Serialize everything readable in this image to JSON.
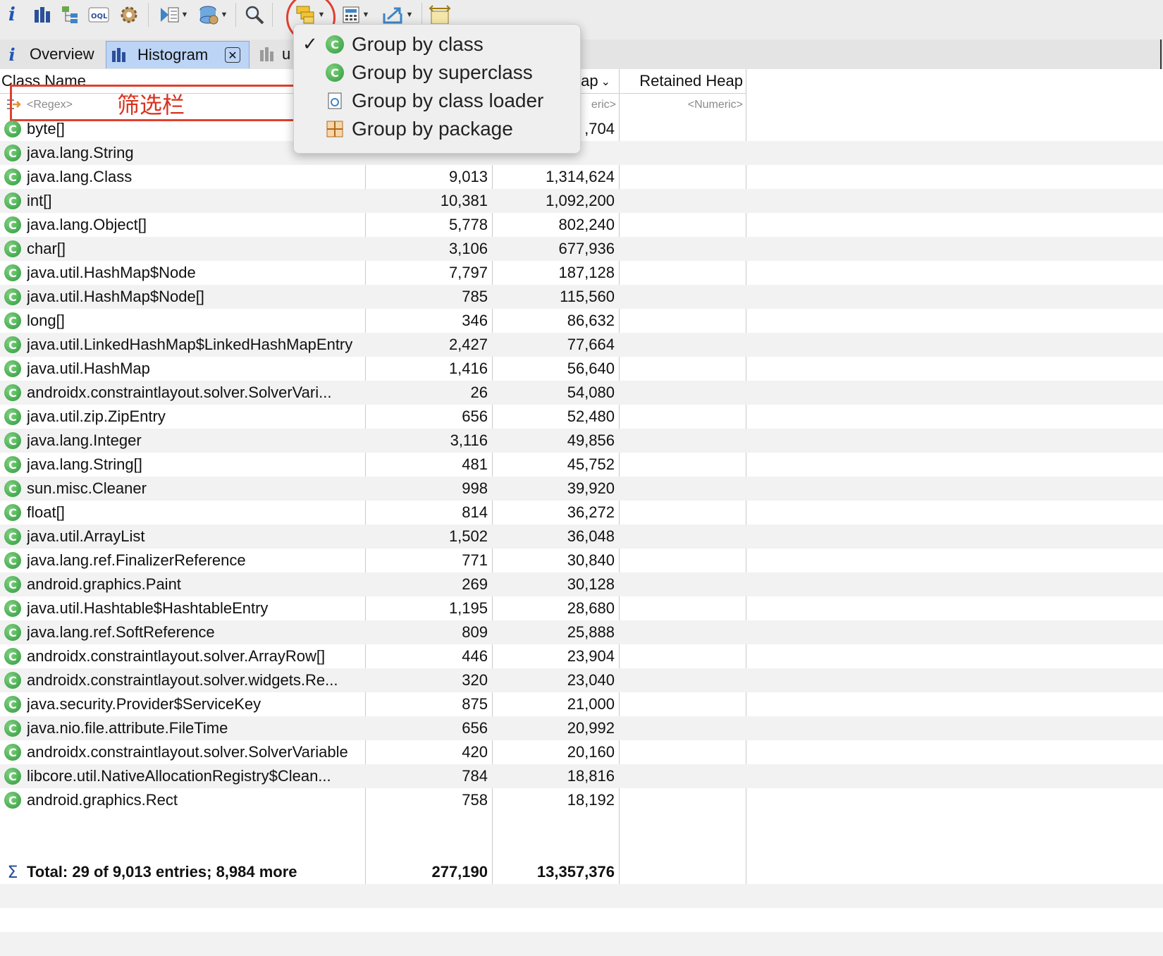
{
  "tabs": [
    {
      "label": "Overview",
      "icon": "info-icon"
    },
    {
      "label": "Histogram",
      "icon": "histogram-icon",
      "active": true
    },
    {
      "label": "u",
      "icon": "histogram-gray-icon"
    }
  ],
  "columns": {
    "class_name": "Class Name",
    "shallow_heap_partial": "ap",
    "retained_heap": "Retained Heap"
  },
  "filter": {
    "regex_placeholder": "<Regex>",
    "numeric_partial": "eric>",
    "numeric_placeholder": "<Numeric>",
    "annotation": "筛选栏"
  },
  "menu": {
    "items": [
      {
        "label": "Group by class",
        "checked": true,
        "icon": "class-icon"
      },
      {
        "label": "Group by superclass",
        "checked": false,
        "icon": "superclass-icon"
      },
      {
        "label": "Group by class loader",
        "checked": false,
        "icon": "class-loader-icon"
      },
      {
        "label": "Group by package",
        "checked": false,
        "icon": "package-icon"
      }
    ]
  },
  "rows": [
    {
      "name": "byte[]",
      "objects": "",
      "shallow": ",704"
    },
    {
      "name": "java.lang.String",
      "objects": "",
      "shallow": ""
    },
    {
      "name": "java.lang.Class",
      "objects": "9,013",
      "shallow": "1,314,624"
    },
    {
      "name": "int[]",
      "objects": "10,381",
      "shallow": "1,092,200"
    },
    {
      "name": "java.lang.Object[]",
      "objects": "5,778",
      "shallow": "802,240"
    },
    {
      "name": "char[]",
      "objects": "3,106",
      "shallow": "677,936"
    },
    {
      "name": "java.util.HashMap$Node",
      "objects": "7,797",
      "shallow": "187,128"
    },
    {
      "name": "java.util.HashMap$Node[]",
      "objects": "785",
      "shallow": "115,560"
    },
    {
      "name": "long[]",
      "objects": "346",
      "shallow": "86,632"
    },
    {
      "name": "java.util.LinkedHashMap$LinkedHashMapEntry",
      "objects": "2,427",
      "shallow": "77,664"
    },
    {
      "name": "java.util.HashMap",
      "objects": "1,416",
      "shallow": "56,640"
    },
    {
      "name": "androidx.constraintlayout.solver.SolverVari...",
      "objects": "26",
      "shallow": "54,080"
    },
    {
      "name": "java.util.zip.ZipEntry",
      "objects": "656",
      "shallow": "52,480"
    },
    {
      "name": "java.lang.Integer",
      "objects": "3,116",
      "shallow": "49,856"
    },
    {
      "name": "java.lang.String[]",
      "objects": "481",
      "shallow": "45,752"
    },
    {
      "name": "sun.misc.Cleaner",
      "objects": "998",
      "shallow": "39,920"
    },
    {
      "name": "float[]",
      "objects": "814",
      "shallow": "36,272"
    },
    {
      "name": "java.util.ArrayList",
      "objects": "1,502",
      "shallow": "36,048"
    },
    {
      "name": "java.lang.ref.FinalizerReference",
      "objects": "771",
      "shallow": "30,840"
    },
    {
      "name": "android.graphics.Paint",
      "objects": "269",
      "shallow": "30,128"
    },
    {
      "name": "java.util.Hashtable$HashtableEntry",
      "objects": "1,195",
      "shallow": "28,680"
    },
    {
      "name": "java.lang.ref.SoftReference",
      "objects": "809",
      "shallow": "25,888"
    },
    {
      "name": "androidx.constraintlayout.solver.ArrayRow[]",
      "objects": "446",
      "shallow": "23,904"
    },
    {
      "name": "androidx.constraintlayout.solver.widgets.Re...",
      "objects": "320",
      "shallow": "23,040"
    },
    {
      "name": "java.security.Provider$ServiceKey",
      "objects": "875",
      "shallow": "21,000"
    },
    {
      "name": "java.nio.file.attribute.FileTime",
      "objects": "656",
      "shallow": "20,992"
    },
    {
      "name": "androidx.constraintlayout.solver.SolverVariable",
      "objects": "420",
      "shallow": "20,160"
    },
    {
      "name": "libcore.util.NativeAllocationRegistry$Clean...",
      "objects": "784",
      "shallow": "18,816"
    },
    {
      "name": "android.graphics.Rect",
      "objects": "758",
      "shallow": "18,192"
    }
  ],
  "total": {
    "label": "Total: 29 of 9,013 entries; 8,984 more",
    "objects": "277,190",
    "shallow": "13,357,376"
  }
}
